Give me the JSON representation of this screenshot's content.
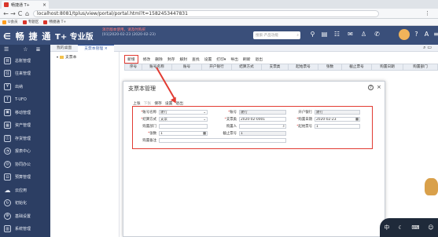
{
  "browser": {
    "tab_title": "畅捷通 T+",
    "url": "localhost:8081/tplus/view/portal/portal.html?t=1582453447831",
    "bookmarks": [
      "U会员",
      "专题区",
      "畅捷通 T+"
    ]
  },
  "header": {
    "logo": "畅 捷 通",
    "product": "T+ 专业版",
    "notice_line1": "演示版本使用，请及时购买",
    "notice_line2": "[01]2020-02-23  (2020-02-23)",
    "search_placeholder": "搜索·产品功能",
    "icons": [
      "grid-icon",
      "home-icon",
      "doc-icon",
      "message-icon",
      "user-icon",
      "phone-icon",
      "monkey-avatar",
      "help-icon",
      "language-icon",
      "more-icon"
    ]
  },
  "sidebar": {
    "items": [
      {
        "label": "总账管理"
      },
      {
        "label": "往来管理"
      },
      {
        "label": "出纳"
      },
      {
        "label": "T-UFO"
      },
      {
        "label": "移动管理"
      },
      {
        "label": "资产管理"
      },
      {
        "label": "存货管理"
      },
      {
        "label": "报表中心"
      },
      {
        "label": "协同办公"
      },
      {
        "label": "预算管理"
      },
      {
        "label": "云应用"
      },
      {
        "label": "初始化"
      },
      {
        "label": "基础设置"
      },
      {
        "label": "系统管理"
      }
    ]
  },
  "subtabs": [
    "我的桌面",
    "支票本管理"
  ],
  "tree": {
    "root": "支票本"
  },
  "toolbar": [
    "新增",
    "修改",
    "删除",
    "封存",
    "解封",
    "查找",
    "设置",
    "打印▾",
    "导出",
    "刷新",
    "退出"
  ],
  "grid": {
    "headers": [
      "序号",
      "账号名称",
      "账号",
      "开户银行",
      "结算方式",
      "支票类",
      "起始票号",
      "张数",
      "截止票号",
      "购置日期",
      "购置部门"
    ]
  },
  "dialog": {
    "title": "支票本管理",
    "tools": [
      "上张",
      "下张",
      "保存",
      "设置",
      "退出"
    ],
    "fields": {
      "account_name": {
        "label": "账号名称",
        "value": "建行"
      },
      "account_no": {
        "label": "账号",
        "value": "建行"
      },
      "bank": {
        "label": "开户银行",
        "value": "建行"
      },
      "settle": {
        "label": "结算方式",
        "value": "支票"
      },
      "cheque_type": {
        "label": "支票类",
        "value": "2020-02-0001"
      },
      "purchase_date": {
        "label": "购置日期",
        "value": "2020-02-23"
      },
      "dept": {
        "label": "购置部门",
        "value": ""
      },
      "buyer": {
        "label": "购置人",
        "value": ""
      },
      "start_no": {
        "label": "起始票号",
        "value": "1"
      },
      "count": {
        "label": "张数",
        "value": "1"
      },
      "end_no": {
        "label": "截止票号",
        "value": "1"
      },
      "remark": {
        "label": "购置备注",
        "value": ""
      }
    }
  }
}
